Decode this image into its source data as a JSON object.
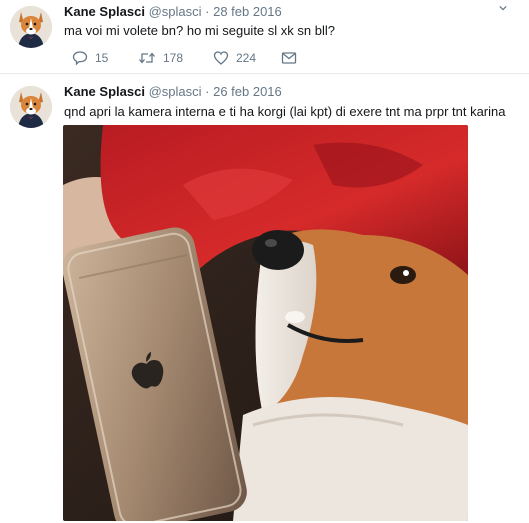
{
  "tweets": [
    {
      "author_name": "Kane Splasci",
      "handle": "@splasci",
      "separator": "·",
      "date": "28 feb 2016",
      "text": "ma voi mi volete bn? ho mi seguite sl xk sn bll?",
      "actions": {
        "replies": "15",
        "retweets": "178",
        "likes": "224"
      },
      "icons": [
        "reply-icon",
        "retweet-icon",
        "heart-icon",
        "envelope-icon",
        "chevron-down-icon"
      ]
    },
    {
      "author_name": "Kane Splasci",
      "handle": "@splasci",
      "separator": "·",
      "date": "26 feb 2016",
      "text": "qnd apri la kamera interna e ti ha korgi (lai kpt) di exere tnt ma prpr tnt karina",
      "media": "photo of a corgi dog lying under a red blanket next to a gold smartphone"
    }
  ],
  "colors": {
    "link_gray": "#657786",
    "divider": "#e6ecf0",
    "text": "#14171a"
  }
}
